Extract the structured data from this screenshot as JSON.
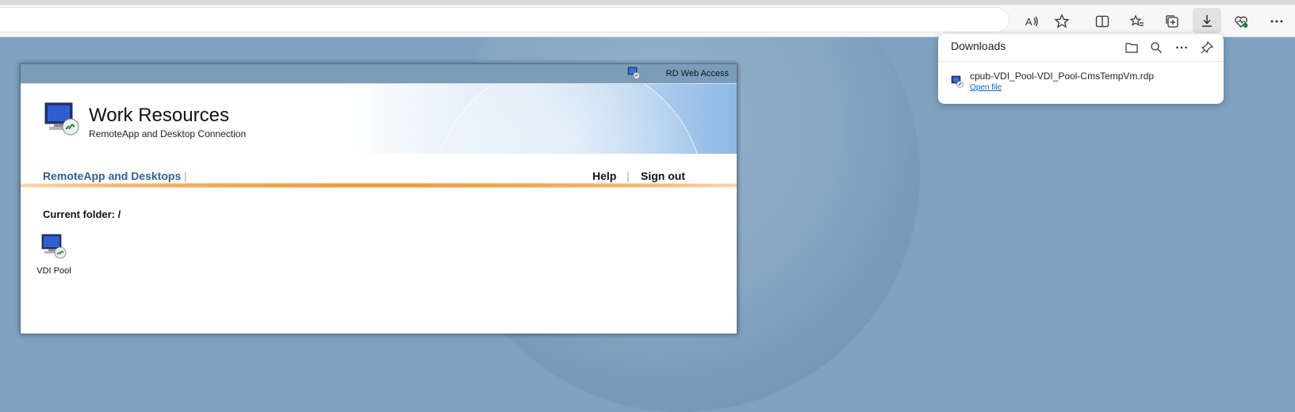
{
  "browser": {
    "toolbar_icons": [
      "read-aloud-icon",
      "favorite-star-icon",
      "split-screen-icon",
      "favorites-icon",
      "collections-icon",
      "downloads-icon",
      "browser-essentials-icon",
      "more-icon"
    ]
  },
  "downloads": {
    "title": "Downloads",
    "header_icons": [
      "folder-icon",
      "search-icon",
      "more-icon",
      "pin-icon"
    ],
    "item": {
      "filename": "cpub-VDI_Pool-VDI_Pool-CmsTempVm.rdp",
      "action": "Open file"
    }
  },
  "rdweb": {
    "window_title": "RD Web Access",
    "title": "Work Resources",
    "subtitle": "RemoteApp and Desktop Connection",
    "nav": {
      "primary": "RemoteApp and Desktops",
      "help": "Help",
      "signout": "Sign out"
    },
    "current_folder": "Current folder: /",
    "resources": [
      {
        "label": "VDI Pool",
        "icon": "remote-desktop-icon"
      }
    ]
  },
  "colors": {
    "background": "#7fa2c0",
    "accent_orange": "#f08a1c",
    "link_blue": "#2e5f9a",
    "open_file_blue": "#0b62c8"
  }
}
